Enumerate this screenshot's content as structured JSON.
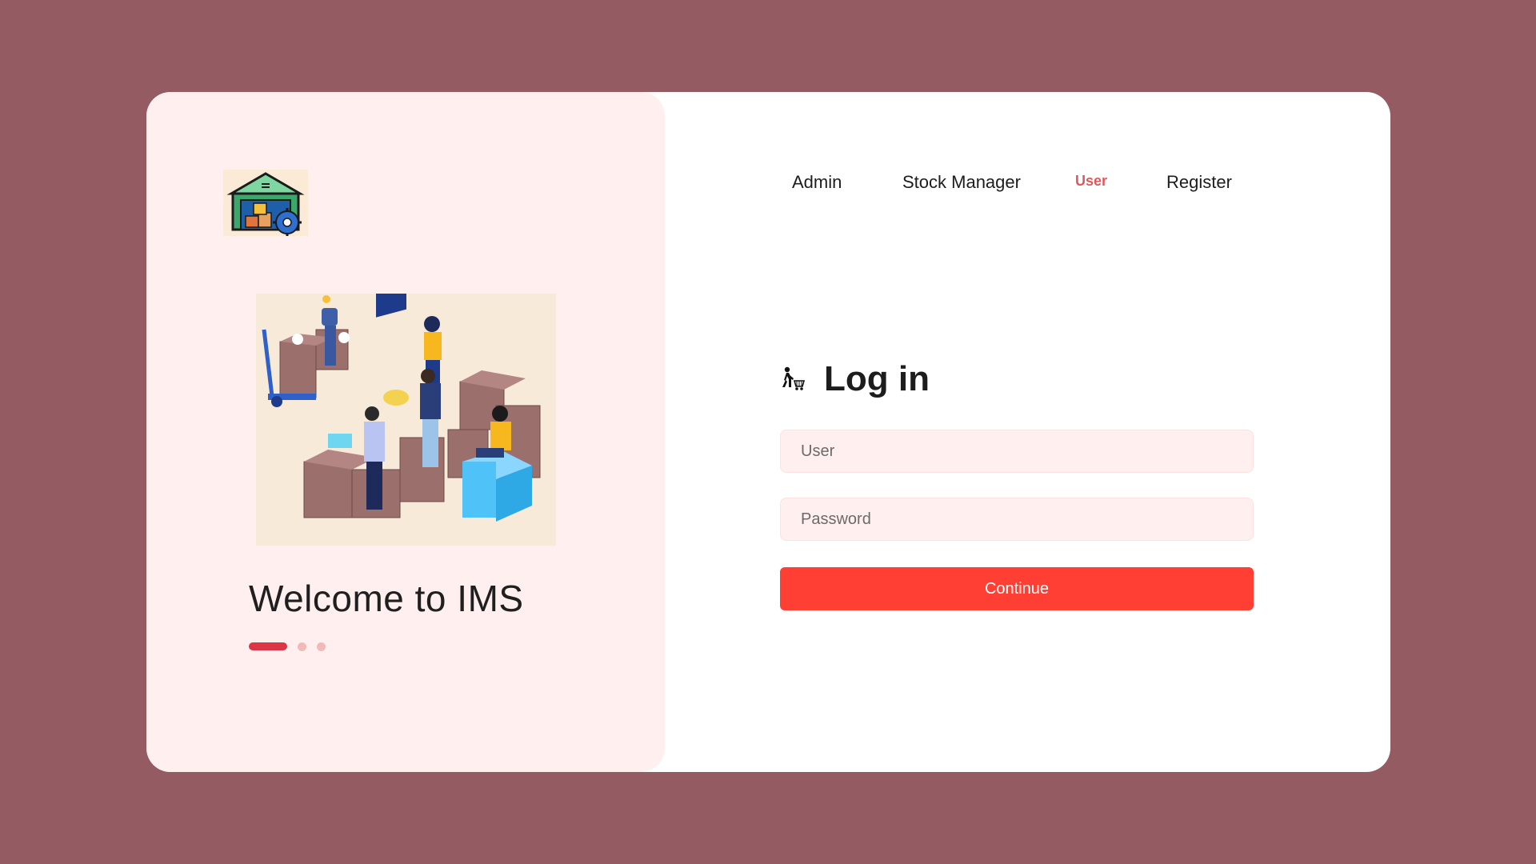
{
  "nav": {
    "items": [
      {
        "label": "Admin",
        "active": false
      },
      {
        "label": "Stock Manager",
        "active": false
      },
      {
        "label": "User",
        "active": true
      },
      {
        "label": "Register",
        "active": false
      }
    ]
  },
  "hero": {
    "welcome_text": "Welcome to IMS",
    "carousel": {
      "count": 3,
      "active_index": 0
    }
  },
  "login": {
    "title": "Log in",
    "icon": "walking-person-cart-icon",
    "user_placeholder": "User",
    "password_placeholder": "Password",
    "submit_label": "Continue"
  },
  "colors": {
    "background": "#955b62",
    "accent": "#ff3f34",
    "active_nav": "#e2585a",
    "panel": "#fff0ef"
  }
}
